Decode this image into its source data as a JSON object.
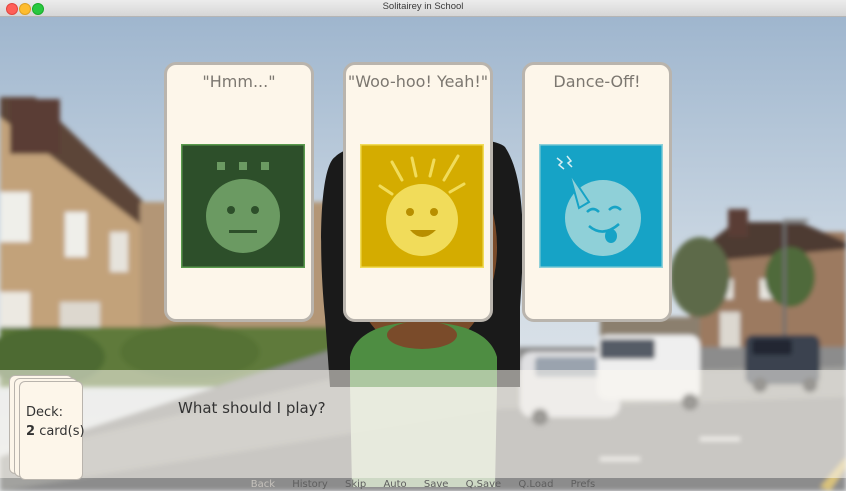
{
  "window": {
    "title": "Solitairey in School"
  },
  "cards": [
    {
      "label": "\"Hmm...\"",
      "icon": "neutral-face-icon",
      "color": "#2d4f2a",
      "face_color": "#6b9a62"
    },
    {
      "label": "\"Woo-hoo! Yeah!\"",
      "icon": "happy-sun-face-icon",
      "color": "#d4ac00",
      "face_color": "#f1dc5a"
    },
    {
      "label": "Dance-Off!",
      "icon": "party-face-icon",
      "color": "#16a3c6",
      "face_color": "#8fd0d8"
    }
  ],
  "dialogue": {
    "text": "What should I play?"
  },
  "deck": {
    "label": "Deck:",
    "count": "2",
    "unit": "card(s)"
  },
  "menu": {
    "back": "Back",
    "history": "History",
    "skip": "Skip",
    "auto": "Auto",
    "save": "Save",
    "qsave": "Q.Save",
    "qload": "Q.Load",
    "prefs": "Prefs"
  }
}
